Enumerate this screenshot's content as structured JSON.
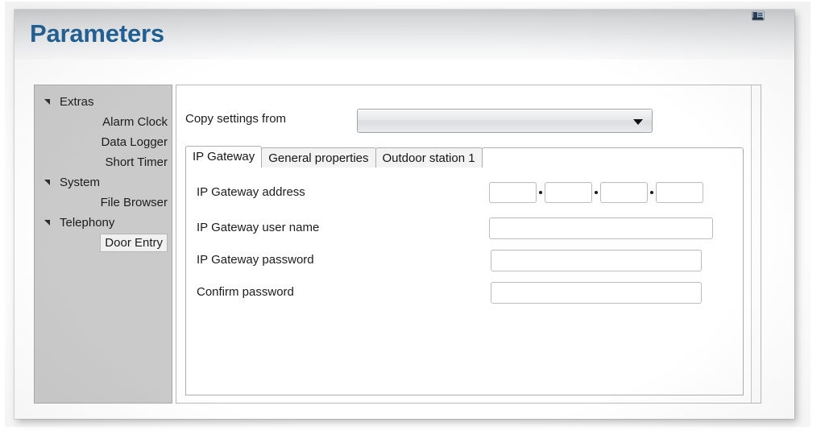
{
  "header": {
    "title": "Parameters",
    "corner_icon": "restore-window-icon"
  },
  "sidebar": {
    "items": [
      {
        "label": "Extras",
        "level": 0,
        "expanded": true,
        "selected": false,
        "arrow": "expander-arrow-icon"
      },
      {
        "label": "Alarm Clock",
        "level": 1,
        "expanded": false,
        "selected": false,
        "arrow": ""
      },
      {
        "label": "Data Logger",
        "level": 1,
        "expanded": false,
        "selected": false,
        "arrow": ""
      },
      {
        "label": "Short Timer",
        "level": 1,
        "expanded": false,
        "selected": false,
        "arrow": ""
      },
      {
        "label": "System",
        "level": 0,
        "expanded": true,
        "selected": false,
        "arrow": "expander-arrow-icon"
      },
      {
        "label": "File Browser",
        "level": 1,
        "expanded": false,
        "selected": false,
        "arrow": ""
      },
      {
        "label": "Telephony",
        "level": 0,
        "expanded": true,
        "selected": false,
        "arrow": "expander-arrow-icon"
      },
      {
        "label": "Door Entry",
        "level": 1,
        "expanded": false,
        "selected": true,
        "arrow": ""
      }
    ]
  },
  "content": {
    "copy_settings": {
      "label": "Copy settings from",
      "value": "",
      "placeholder": "",
      "dropdown_icon": "chevron-down-icon"
    },
    "tabs": [
      {
        "label": "IP Gateway",
        "active": true
      },
      {
        "label": "General properties",
        "active": false
      },
      {
        "label": "Outdoor station 1",
        "active": false
      }
    ],
    "form": {
      "fields": [
        {
          "label": "IP Gateway address",
          "type": "ip",
          "octets": [
            "",
            "",
            "",
            ""
          ],
          "separator": "."
        },
        {
          "label": "IP Gateway user name",
          "type": "text",
          "value": ""
        },
        {
          "label": "IP Gateway password",
          "type": "password",
          "value": ""
        },
        {
          "label": "Confirm password",
          "type": "password",
          "value": ""
        }
      ]
    }
  },
  "colors": {
    "title": "#1d5d93",
    "sidebar_bg": "#cacaca",
    "panel_border": "#b8b8b8",
    "tab_border": "#adadad"
  }
}
